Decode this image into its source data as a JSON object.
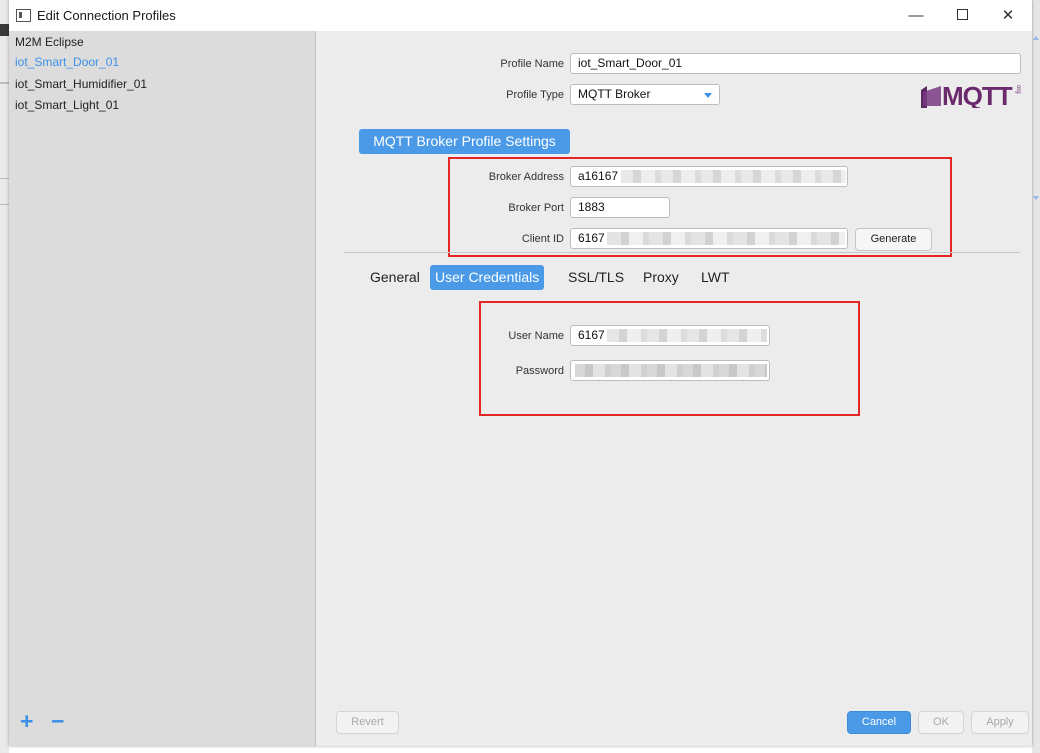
{
  "window": {
    "title": "Edit Connection Profiles",
    "minimize_glyph": "—",
    "close_glyph": "✕"
  },
  "sidebar": {
    "profiles": [
      {
        "label": "M2M Eclipse",
        "selected": false
      },
      {
        "label": "iot_Smart_Door_01",
        "selected": true
      },
      {
        "label": "iot_Smart_Humidifier_01",
        "selected": false
      },
      {
        "label": "iot_Smart_Light_01",
        "selected": false
      }
    ],
    "add_glyph": "+",
    "remove_glyph": "−"
  },
  "profile": {
    "name_label": "Profile Name",
    "name_value": "iot_Smart_Door_01",
    "type_label": "Profile Type",
    "type_value": "MQTT Broker"
  },
  "logo": {
    "text": "MQTT",
    "suffix": "org",
    "color": "#6b2a6e"
  },
  "broker": {
    "section_title": "MQTT Broker Profile Settings",
    "address_label": "Broker Address",
    "address_value": "a16167",
    "port_label": "Broker Port",
    "port_value": "1883",
    "client_id_label": "Client ID",
    "client_id_value": "6167",
    "generate_label": "Generate"
  },
  "tabs": [
    {
      "label": "General",
      "active": false
    },
    {
      "label": "User Credentials",
      "active": true
    },
    {
      "label": "SSL/TLS",
      "active": false
    },
    {
      "label": "Proxy",
      "active": false
    },
    {
      "label": "LWT",
      "active": false
    }
  ],
  "credentials": {
    "user_label": "User Name",
    "user_value": "6167",
    "password_label": "Password"
  },
  "footer": {
    "revert_label": "Revert",
    "cancel_label": "Cancel",
    "ok_label": "OK",
    "apply_label": "Apply"
  },
  "colors": {
    "accent": "#4a9ae8",
    "highlight_box": "#e32626",
    "selected_text": "#3c91e6"
  }
}
